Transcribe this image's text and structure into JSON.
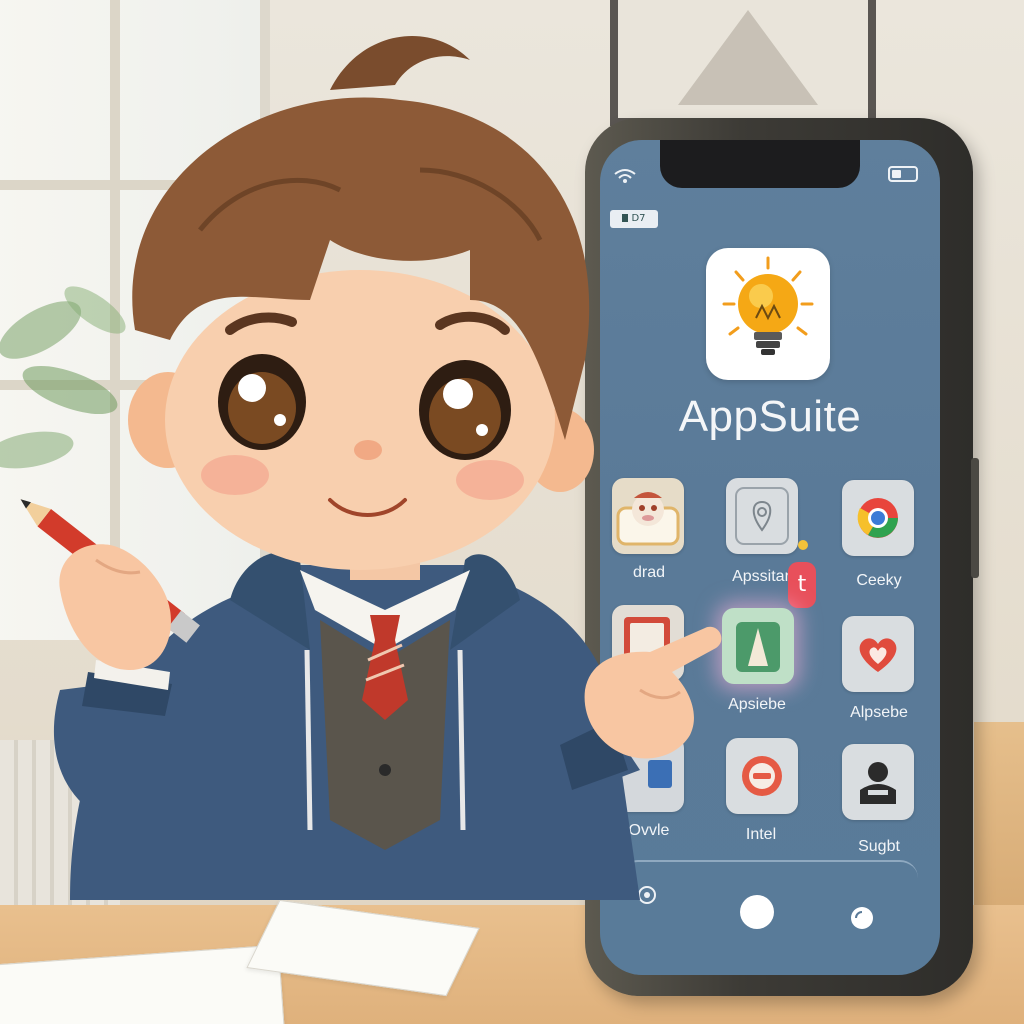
{
  "app": {
    "title": "AppSuite",
    "status_badge": "D7"
  },
  "grid": [
    {
      "label": "drad",
      "icon": "mascot-icon"
    },
    {
      "label": "Apssitar",
      "icon": "location-pin-icon"
    },
    {
      "label": "Ceeky",
      "icon": "browser-icon"
    },
    {
      "label": "",
      "icon": "tablet-icon"
    },
    {
      "label": "Apsiebe",
      "icon": "navigation-icon"
    },
    {
      "label": "Alpsebe",
      "icon": "heart-icon"
    },
    {
      "label": "Ovvle",
      "icon": "blue-square-icon"
    },
    {
      "label": "Intel",
      "icon": "minus-circle-icon"
    },
    {
      "label": "Sugbt",
      "icon": "person-icon"
    }
  ],
  "notification_badge": "t",
  "colors": {
    "screen": "#5a7a98",
    "hoodie": "#3e5a7e",
    "hair": "#8d5a37",
    "tie": "#c0392b",
    "bulb": "#f4a514"
  }
}
